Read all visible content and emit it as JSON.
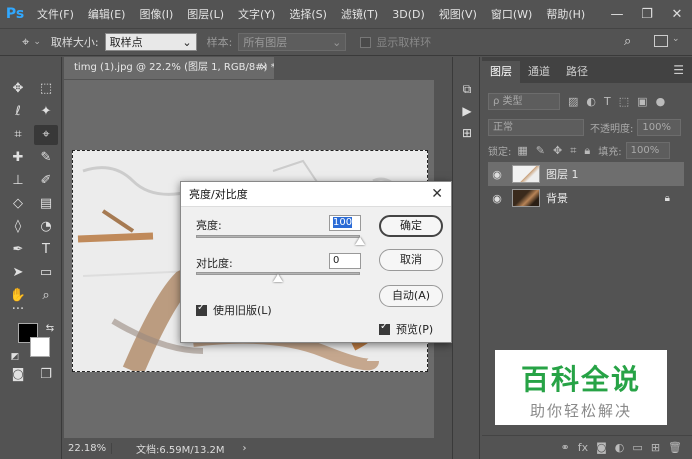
{
  "app": {
    "logo": "Ps"
  },
  "menu": [
    "文件(F)",
    "编辑(E)",
    "图像(I)",
    "图层(L)",
    "文字(Y)",
    "选择(S)",
    "滤镜(T)",
    "3D(D)",
    "视图(V)",
    "窗口(W)",
    "帮助(H)"
  ],
  "window_controls": {
    "minimize": "—",
    "maximize": "❐",
    "close": "✕"
  },
  "options": {
    "sample_size_label": "取样大小:",
    "sample_size_value": "取样点",
    "sample_label": "样本:",
    "sample_value": "所有图层",
    "show_ring_label": "显示取样环"
  },
  "document": {
    "tab_title": "timg (1).jpg @ 22.2% (图层 1, RGB/8#) *",
    "tab_close": "×",
    "zoom": "22.18%",
    "doc_info": "文档:6.59M/13.2M",
    "status_arrow": "›"
  },
  "dialog": {
    "title": "亮度/对比度",
    "close": "✕",
    "brightness_label": "亮度:",
    "brightness_value": "100",
    "contrast_label": "对比度:",
    "contrast_value": "0",
    "legacy_label": "使用旧版(L)",
    "legacy_checked": true,
    "ok_label": "确定",
    "cancel_label": "取消",
    "auto_label": "自动(A)",
    "preview_label": "预览(P)",
    "preview_checked": true
  },
  "layers_panel": {
    "tabs": [
      "图层",
      "通道",
      "路径"
    ],
    "menu_icon": "☰",
    "filter_kind": "ρ 类型",
    "blend_mode": "正常",
    "opacity_label": "不透明度:",
    "opacity_value": "100%",
    "lock_label": "锁定:",
    "fill_label": "填充:",
    "fill_value": "100%",
    "layers": [
      {
        "name": "图层 1",
        "selected": true,
        "locked": false
      },
      {
        "name": "背景",
        "selected": false,
        "locked": true
      }
    ]
  },
  "watermark": {
    "big": "百科全说",
    "small": "助你轻松解决"
  },
  "colors": {
    "ui_bg": "#535353",
    "canvas_bg": "#6b6b6b",
    "accent": "#31a8ff",
    "watermark_green": "#27a346"
  }
}
